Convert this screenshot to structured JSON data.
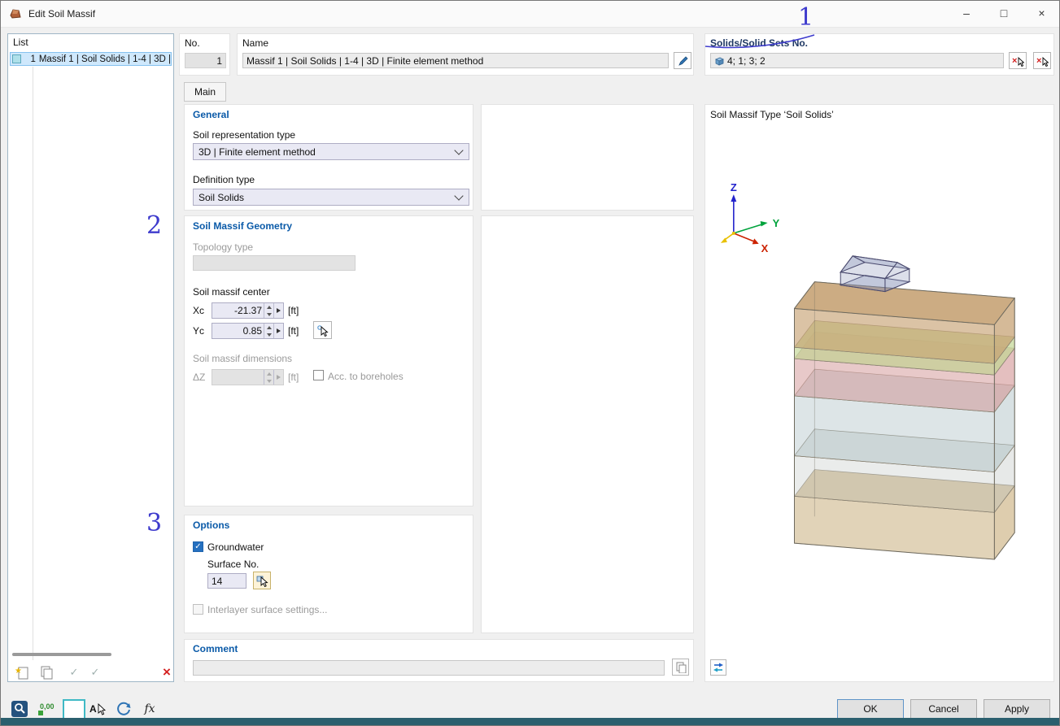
{
  "window": {
    "title": "Edit Soil Massif"
  },
  "window_controls": {
    "minimize": "–",
    "maximize": "□",
    "close": "×"
  },
  "list_panel": {
    "title": "List",
    "items": [
      {
        "no": "1",
        "label": "Massif 1 | Soil Solids | 1-4 | 3D |"
      }
    ]
  },
  "header": {
    "no_label": "No.",
    "no_value": "1",
    "name_label": "Name",
    "name_value": "Massif 1 | Soil Solids | 1-4 | 3D | Finite element method",
    "solids_label": "Solids/Solid Sets No.",
    "solids_value": "4; 1; 3; 2"
  },
  "tabs": {
    "main": "Main"
  },
  "sections": {
    "general": {
      "title": "General",
      "soil_representation_label": "Soil representation type",
      "soil_representation_value": "3D | Finite element method",
      "definition_type_label": "Definition type",
      "definition_type_value": "Soil Solids"
    },
    "geometry": {
      "title": "Soil Massif Geometry",
      "topology_label": "Topology type",
      "topology_value": "",
      "center_label": "Soil massif center",
      "xc_label": "Xc",
      "xc_value": "-21.37",
      "xc_unit": "[ft]",
      "yc_label": "Yc",
      "yc_value": "0.85",
      "yc_unit": "[ft]",
      "dimensions_label": "Soil massif dimensions",
      "dz_label": "ΔZ",
      "dz_value": "",
      "dz_unit": "[ft]",
      "boreholes_label": "Acc. to boreholes"
    },
    "options": {
      "title": "Options",
      "groundwater_label": "Groundwater",
      "groundwater_checked": true,
      "surface_no_label": "Surface No.",
      "surface_no_value": "14",
      "interlayer_label": "Interlayer surface settings..."
    },
    "comment": {
      "title": "Comment",
      "value": ""
    }
  },
  "preview": {
    "title": "Soil Massif Type ‘Soil Solids’",
    "axes": {
      "z": "Z",
      "y": "Y",
      "x": "X"
    },
    "layer_colors": [
      "#c7a375",
      "#c6d89a",
      "#d69c9c",
      "#a9bdc2",
      "#c2c9c5",
      "#c9ae7d"
    ]
  },
  "annotations": {
    "n1": "1",
    "n2": "2",
    "n3": "3"
  },
  "footer": {
    "ok": "OK",
    "cancel": "Cancel",
    "apply": "Apply"
  },
  "toolbar": {
    "zeros": "0,00",
    "fx": "fx",
    "a": "A"
  },
  "misc": {
    "check": "✓",
    "star": "★",
    "red_x": "×"
  },
  "colors": {
    "accent_blue": "#0a5aa8",
    "annotation": "#3e3bcd",
    "axis_z": "#2222cc",
    "axis_y": "#00a33c",
    "axis_x": "#cc2200"
  }
}
